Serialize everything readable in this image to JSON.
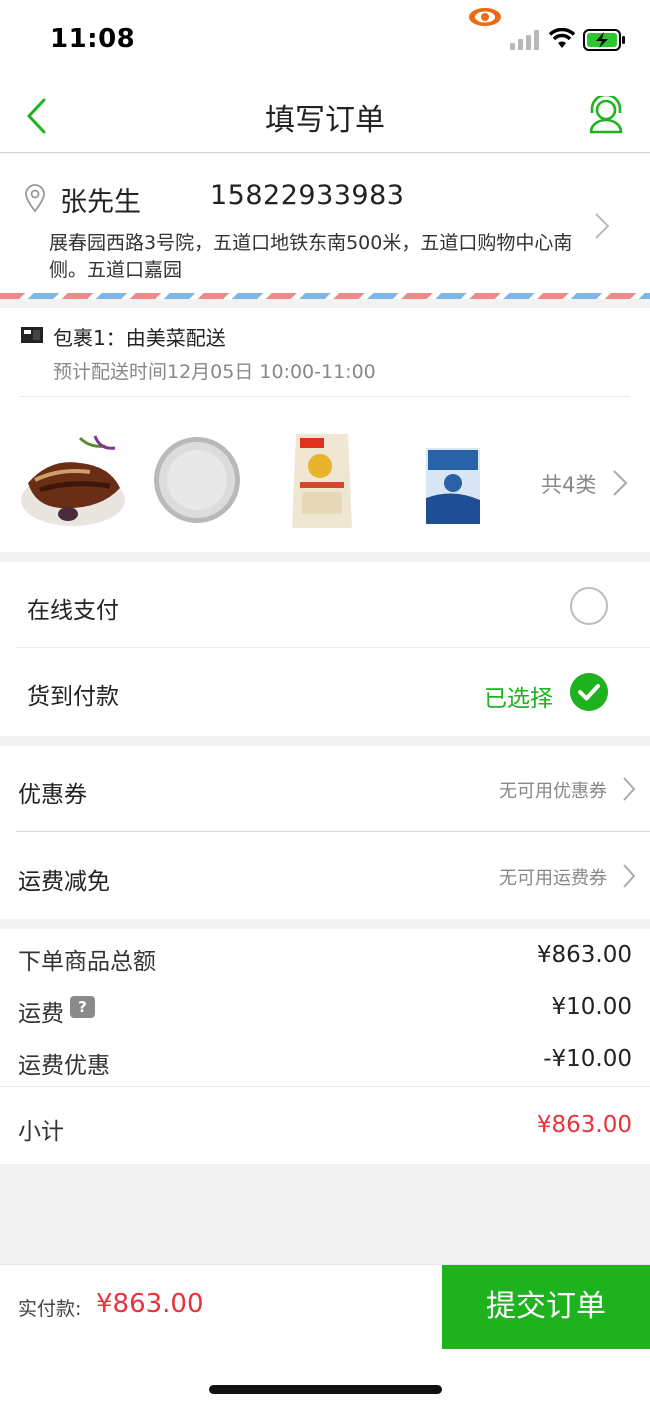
{
  "status_bar": {
    "time": "11:08"
  },
  "nav": {
    "title": "填写订单",
    "back_icon": "chevron-left-icon",
    "service_icon": "customer-service-icon"
  },
  "address": {
    "name": "张先生",
    "phone": "15822933983",
    "detail": "展春园西路3号院，五道口地铁东南500米，五道口购物中心南侧。五道口嘉园"
  },
  "package": {
    "title": "包裹1：由美菜配送",
    "delivery_time": "预计配送时间12月05日 10:00-11:00",
    "items": [
      {
        "name": "braised-pork-dish"
      },
      {
        "name": "vermicelli-plate"
      },
      {
        "name": "rice-bag"
      },
      {
        "name": "salt-bag"
      }
    ],
    "count_label": "共4类"
  },
  "payment": {
    "online": "在线支付",
    "cod": "货到付款",
    "cod_status": "已选择"
  },
  "discounts": {
    "coupon_label": "优惠券",
    "coupon_value": "无可用优惠券",
    "shipping_label": "运费减免",
    "shipping_value": "无可用运费券"
  },
  "summary": {
    "goods_total_label": "下单商品总额",
    "goods_total": "¥863.00",
    "shipping_label": "运费",
    "shipping": "¥10.00",
    "shipping_discount_label": "运费优惠",
    "shipping_discount": "-¥10.00",
    "subtotal_label": "小计",
    "subtotal": "¥863.00",
    "help_mark": "?"
  },
  "footer": {
    "actual_label": "实付款:",
    "actual_amount": "¥863.00",
    "submit_label": "提交订单"
  },
  "colors": {
    "accent_green": "#1fb21f",
    "price_red": "#e8323c"
  }
}
